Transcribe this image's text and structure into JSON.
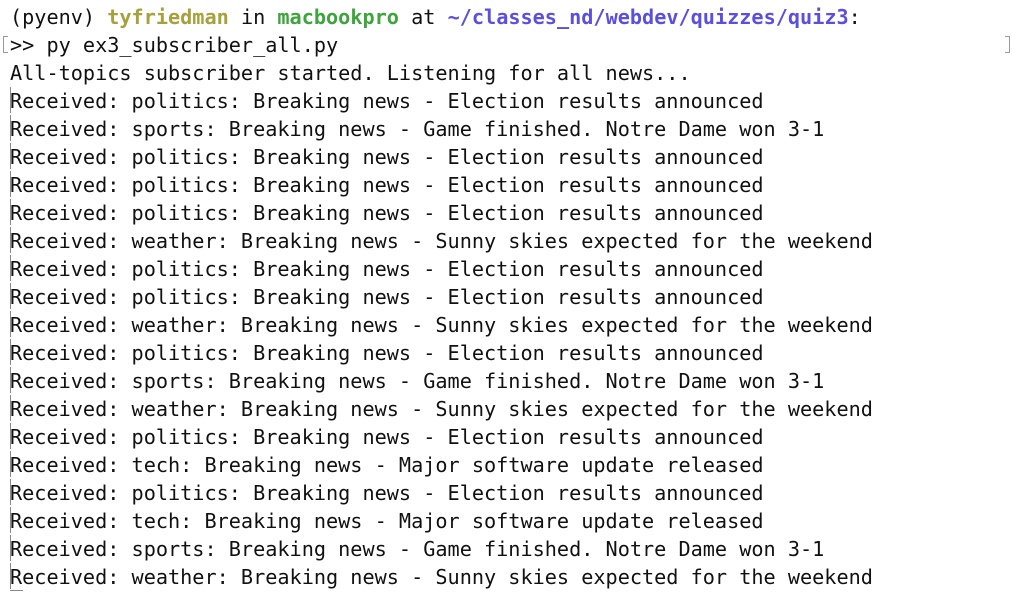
{
  "prompt": {
    "env": "(pyenv)",
    "user": "tyfriedman",
    "in": "in",
    "host": "macbookpro",
    "at": "at",
    "path": "~/classes_nd/webdev/quizzes/quiz3",
    "suffix": ":"
  },
  "command": {
    "marker": ">>",
    "text": "py ex3_subscriber_all.py"
  },
  "status_line": "All-topics subscriber started. Listening for all news...",
  "output_lines": [
    "Received: politics: Breaking news - Election results announced",
    "Received: sports: Breaking news - Game finished. Notre Dame won 3-1",
    "Received: politics: Breaking news - Election results announced",
    "Received: politics: Breaking news - Election results announced",
    "Received: politics: Breaking news - Election results announced",
    "Received: weather: Breaking news - Sunny skies expected for the weekend",
    "Received: politics: Breaking news - Election results announced",
    "Received: politics: Breaking news - Election results announced",
    "Received: weather: Breaking news - Sunny skies expected for the weekend",
    "Received: politics: Breaking news - Election results announced",
    "Received: sports: Breaking news - Game finished. Notre Dame won 3-1",
    "Received: weather: Breaking news - Sunny skies expected for the weekend",
    "Received: politics: Breaking news - Election results announced",
    "Received: tech: Breaking news - Major software update released",
    "Received: politics: Breaking news - Election results announced",
    "Received: tech: Breaking news - Major software update released",
    "Received: sports: Breaking news - Game finished. Notre Dame won 3-1",
    "Received: weather: Breaking news - Sunny skies expected for the weekend"
  ],
  "colors": {
    "user": "#a6a13b",
    "host": "#3ea43c",
    "path": "#5b4fe0",
    "text": "#111111",
    "background": "#ffffff"
  }
}
